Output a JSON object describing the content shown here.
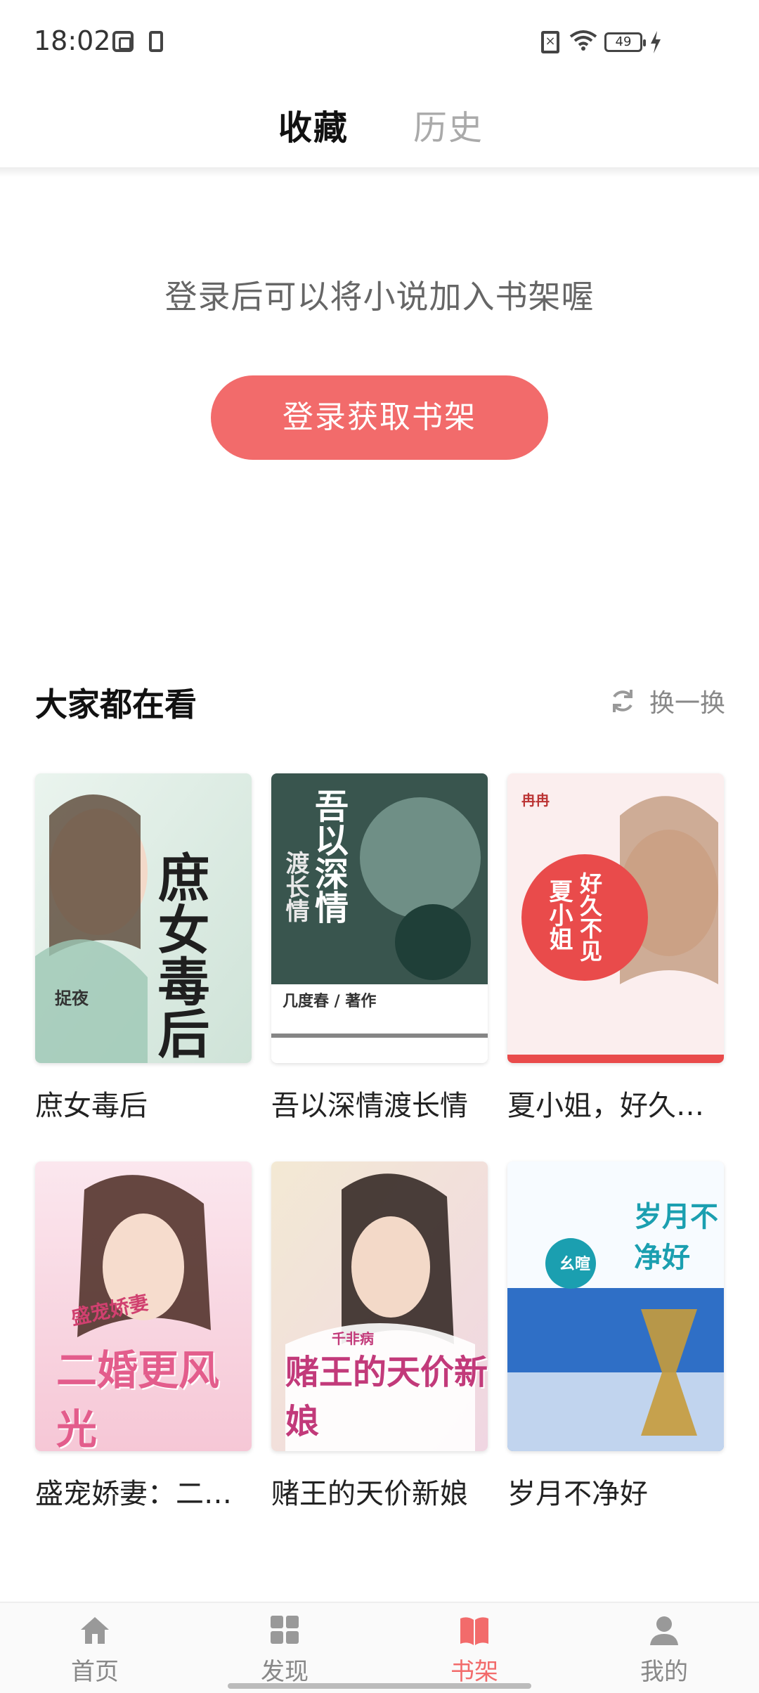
{
  "status_bar": {
    "time": "18:02",
    "battery_level": "49",
    "icons": [
      "app-icon",
      "phone-icon",
      "sim-icon",
      "wifi-icon",
      "battery-icon",
      "charging-icon"
    ]
  },
  "top_tabs": [
    {
      "label": "收藏",
      "active": true
    },
    {
      "label": "历史",
      "active": false
    }
  ],
  "bookshelf": {
    "empty_hint": "登录后可以将小说加入书架喔",
    "login_button": "登录获取书架"
  },
  "recommend": {
    "title": "大家都在看",
    "refresh_label": "换一换",
    "refresh_icon": "refresh-icon",
    "books": [
      {
        "title": "庶女毒后",
        "cover_text": "庶女毒后",
        "cover_author": "捉夜",
        "palette": [
          "#eef4ee",
          "#cfe3d8",
          "#2a2a2a"
        ]
      },
      {
        "title": "吾以深情渡长情",
        "cover_text": "吾以深情",
        "cover_sub": "渡长情",
        "cover_author": "几度春 / 著作",
        "palette": [
          "#2f4a44",
          "#6a8f86",
          "#ffffff"
        ]
      },
      {
        "title": "夏小姐，好久…",
        "cover_text": "夏小姐",
        "cover_sub": "好久不见",
        "cover_author": "冉冉",
        "palette": [
          "#fbeeee",
          "#e94b4b",
          "#ffffff"
        ]
      },
      {
        "title": "盛宠娇妻：二…",
        "cover_text": "二婚更风光",
        "cover_sub": "盛宠娇妻",
        "palette": [
          "#fbe1ea",
          "#e35d8c",
          "#ffffff"
        ]
      },
      {
        "title": "赌王的天价新娘",
        "cover_text": "赌王的天价新娘",
        "cover_author": "千非病",
        "palette": [
          "#f2e7e0",
          "#c23a7a",
          "#ffffff"
        ]
      },
      {
        "title": "岁月不净好",
        "cover_text": "岁月不净好",
        "cover_author": "幺暄",
        "palette": [
          "#f7fbff",
          "#2f7fd6",
          "#1b9fb0"
        ]
      }
    ]
  },
  "bottom_nav": [
    {
      "label": "首页",
      "icon": "home-icon",
      "active": false
    },
    {
      "label": "发现",
      "icon": "discover-grid-icon",
      "active": false
    },
    {
      "label": "书架",
      "icon": "bookshelf-icon",
      "active": true
    },
    {
      "label": "我的",
      "icon": "profile-icon",
      "active": false
    }
  ],
  "colors": {
    "accent": "#f26b6b",
    "inactive": "#888888",
    "text": "#111111"
  }
}
